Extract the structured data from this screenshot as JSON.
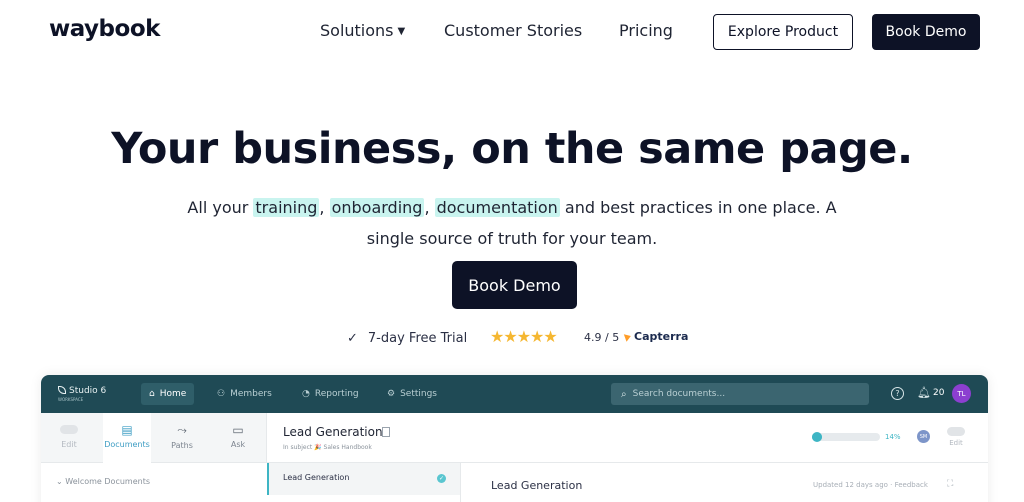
{
  "nav": {
    "logo": "waybook",
    "links": [
      "Solutions",
      "Customer Stories",
      "Pricing"
    ],
    "explore_label": "Explore Product",
    "demo_label": "Book Demo"
  },
  "hero": {
    "title": "Your business, on the same page.",
    "sub_pre": "All your ",
    "hl1": "training",
    "sep1": ", ",
    "hl2": "onboarding",
    "sep2": ", ",
    "hl3": "documentation",
    "sub_post": " and best practices in one place. A single source of truth for your team.",
    "cta": "Book Demo",
    "trial": "7-day Free Trial",
    "stars": "★★★★★",
    "rating_value": 4.9,
    "rating": "4.9 / 5",
    "review_brand": "Capterra"
  },
  "app": {
    "workspace": "Studio 6",
    "workspace_sub": "WORKSPACE",
    "tabs": [
      "Home",
      "Members",
      "Reporting",
      "Settings"
    ],
    "search_placeholder": "Search documents...",
    "notif_count": "20",
    "avatar": "TL",
    "tools": [
      "Edit",
      "Documents",
      "Paths",
      "Ask"
    ],
    "doc_title": "Lead Generation",
    "doc_subject": "In subject 🎉 Sales Handbook",
    "progress_pct": "14%",
    "progress_value": 0.14,
    "mini_avatar": "SM",
    "doc_edit": "Edit",
    "welcome": "Welcome Documents",
    "list_item": "Lead Generation",
    "content_title": "Lead Generation",
    "updated": "Updated 12 days ago · Feedback"
  },
  "colors": {
    "primary": "#0d1226",
    "highlight": "#c9f4ef",
    "app_header": "#1f4a55",
    "star": "#f5b731",
    "accent": "#3eb5c4"
  }
}
